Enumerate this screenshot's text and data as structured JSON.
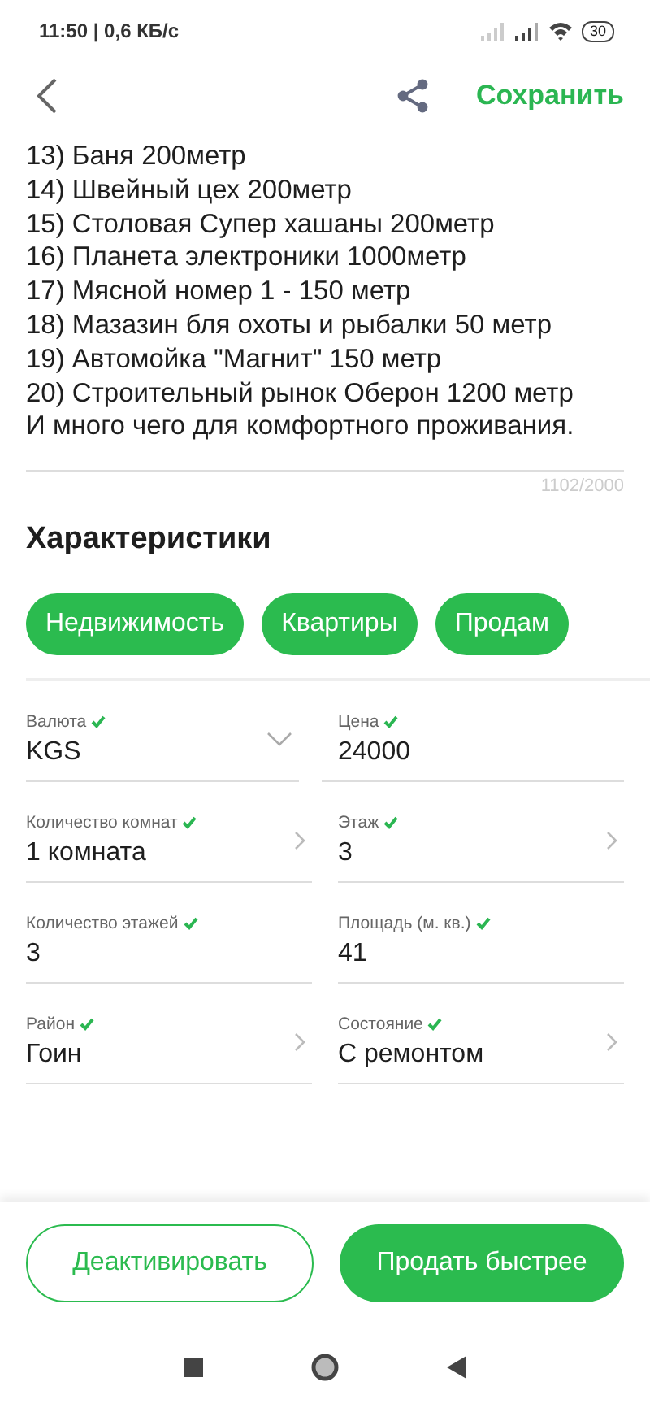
{
  "status_bar": {
    "time": "11:50 | 0,6 КБ/с",
    "battery": "30"
  },
  "header": {
    "save": "Сохранить"
  },
  "description": {
    "lines": [
      "13) Баня 200метр",
      "14) Швейный цех 200метр",
      "15) Столовая Супер хашаны 200метр",
      "16) Планета электроники 1000метр",
      "17) Мясной номер 1 - 150 метр",
      "18) Мазазин бля охоты и рыбалки 50 метр",
      "19) Автомойка \"Магнит\" 150 метр",
      "20) Строительный рынок Оберон 1200 метр",
      "И много чего для комфортного проживания."
    ],
    "counter": "1102/2000"
  },
  "characteristics": {
    "title": "Характеристики",
    "tags": [
      "Недвижимость",
      "Квартиры",
      "Продам"
    ],
    "fields": [
      {
        "label": "Валюта",
        "value": "KGS",
        "valid": true,
        "kind": "select"
      },
      {
        "label": "Цена",
        "value": "24000",
        "valid": true,
        "kind": "input"
      },
      {
        "label": "Количество комнат",
        "value": "1 комната",
        "valid": true,
        "kind": "picker"
      },
      {
        "label": "Этаж",
        "value": "3",
        "valid": true,
        "kind": "picker"
      },
      {
        "label": "Количество этажей",
        "value": "3",
        "valid": true,
        "kind": "input"
      },
      {
        "label": "Площадь (м. кв.)",
        "value": "41",
        "valid": true,
        "kind": "input"
      },
      {
        "label": "Район",
        "value": "Гоин",
        "valid": true,
        "kind": "picker"
      },
      {
        "label": "Состояние",
        "value": "С ремонтом",
        "valid": true,
        "kind": "picker"
      }
    ]
  },
  "actions": {
    "deactivate": "Деактивировать",
    "promote": "Продать быстрее"
  }
}
